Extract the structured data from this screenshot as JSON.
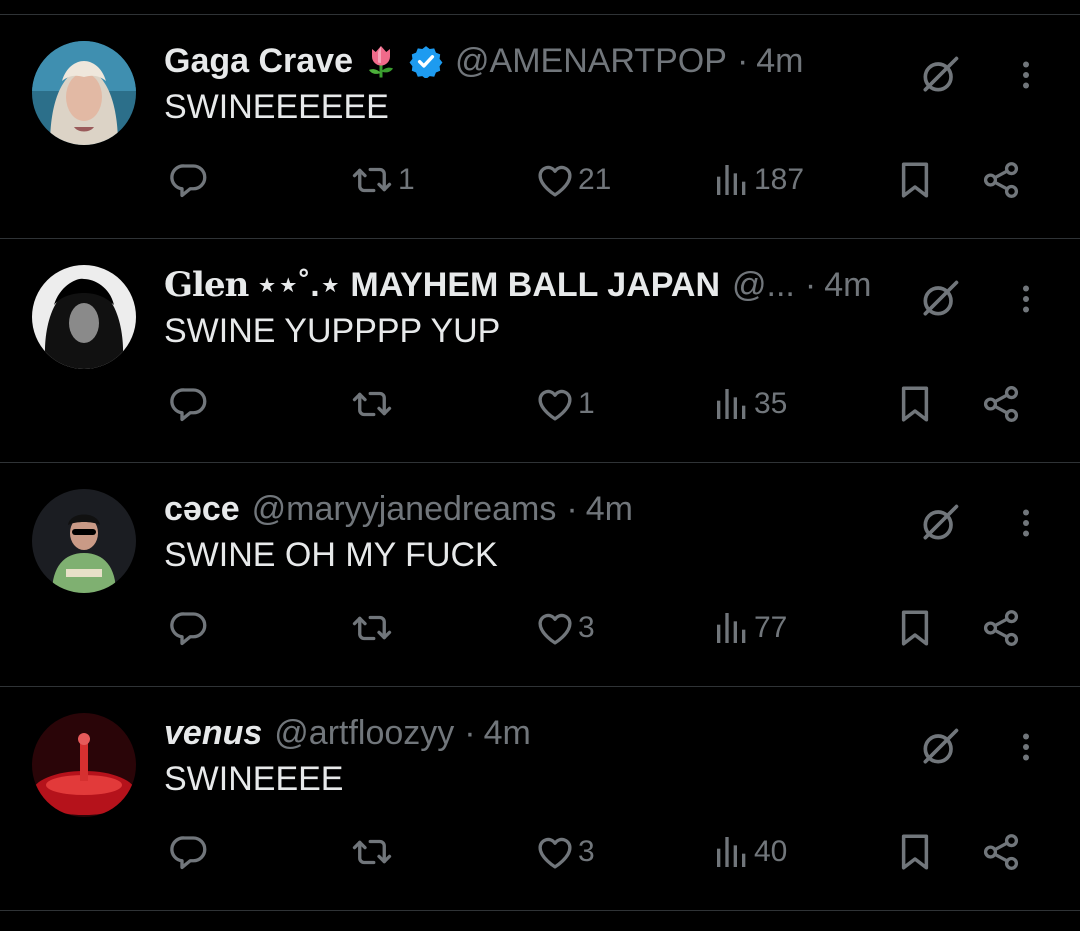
{
  "tweets": [
    {
      "name": "Gaga Crave",
      "name_suffix": "🌷",
      "verified": true,
      "handle": "@AMENARTPOP",
      "separator": "·",
      "time": "4m",
      "text": "SWINEEEEEE",
      "reply_count": "",
      "retweet_count": "1",
      "like_count": "21",
      "view_count": "187",
      "avatar_icon": "avatar-gaga-crave"
    },
    {
      "name_prefix": "Glen",
      "name": "⋆⋆˚.⋆ MAYHEM BALL JAPAN",
      "verified": false,
      "handle": "@...",
      "separator": "·",
      "time": "4m",
      "text": "SWINE YUPPPP YUP",
      "reply_count": "",
      "retweet_count": "",
      "like_count": "1",
      "view_count": "35",
      "avatar_icon": "avatar-glen"
    },
    {
      "name": "cəce",
      "verified": false,
      "handle": "@maryyjanedreams",
      "separator": "·",
      "time": "4m",
      "text": "SWINE OH MY FUCK",
      "reply_count": "",
      "retweet_count": "",
      "like_count": "3",
      "view_count": "77",
      "avatar_icon": "avatar-cece"
    },
    {
      "name": "venus",
      "verified": false,
      "handle": "@artfloozyy",
      "separator": "·",
      "time": "4m",
      "text": "SWINEEEE",
      "reply_count": "",
      "retweet_count": "",
      "like_count": "3",
      "view_count": "40",
      "avatar_icon": "avatar-venus"
    }
  ],
  "colors": {
    "background": "#000000",
    "text": "#e7e9ea",
    "secondary": "#71767b",
    "divider": "#2f3336",
    "verified": "#1d9bf0"
  }
}
